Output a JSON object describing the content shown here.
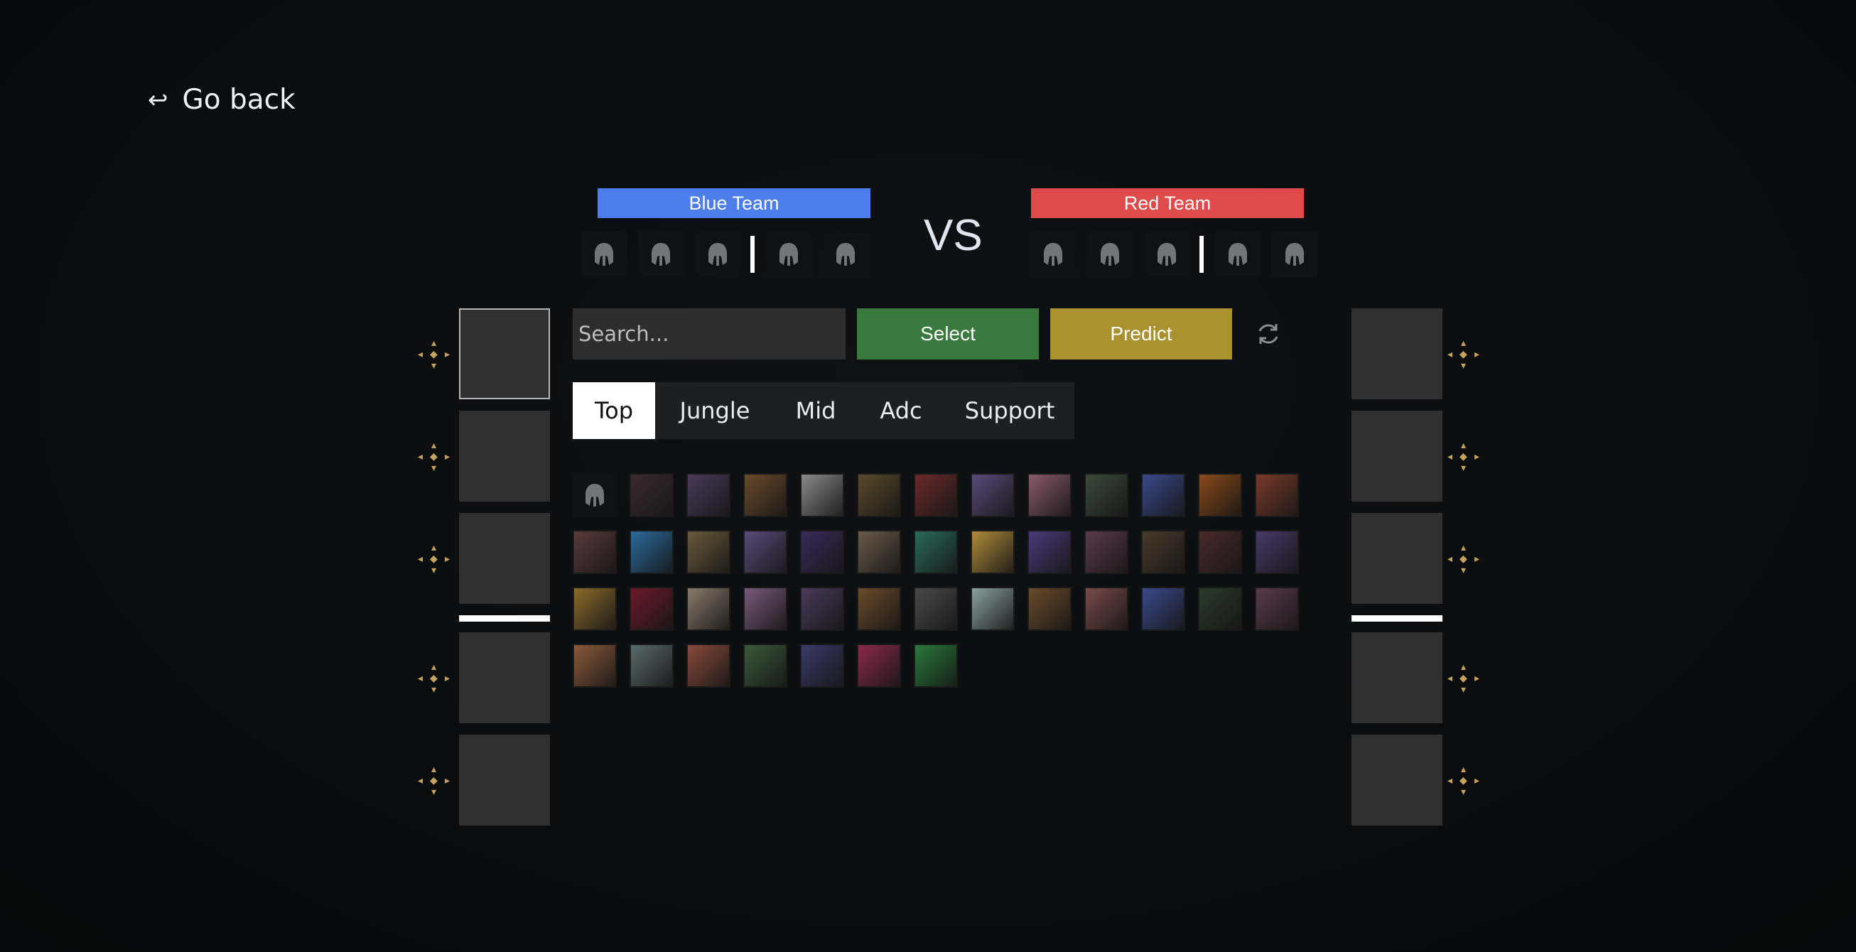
{
  "nav": {
    "back_label": "Go back",
    "back_icon": "return-arrow-icon"
  },
  "teams": {
    "blue": {
      "label": "Blue Team",
      "color": "#4b7ded"
    },
    "red": {
      "label": "Red Team",
      "color": "#e04a4a"
    },
    "vs_label": "VS"
  },
  "controls": {
    "search_placeholder": "Search...",
    "select_label": "Select",
    "predict_label": "Predict",
    "select_color": "#3a7a3e",
    "predict_color": "#a9912f",
    "refresh_icon": "refresh-icon"
  },
  "roles": {
    "selected": "Top",
    "items": [
      "Top",
      "Jungle",
      "Mid",
      "Adc",
      "Support"
    ]
  },
  "champions": {
    "placeholder_icon": "helmet-icon",
    "count": 46,
    "tile_colors": [
      "#0d1216",
      "#3a2a30",
      "#4a3a5a",
      "#6a4a2a",
      "#8a8a8a",
      "#5a4a2a",
      "#6a2a2a",
      "#5a4a7a",
      "#8a5a6a",
      "#3a4a3a",
      "#3a4a8a",
      "#8a4a1a",
      "#7a3a2a",
      "#5a3a3a",
      "#2a6a9a",
      "#6a5a3a",
      "#5a4a7a",
      "#3a2a5a",
      "#6a5a4a",
      "#2a6a5a",
      "#b08a3a",
      "#4a3a7a",
      "#5a3a4a",
      "#4a3a2a",
      "#4a2a2a",
      "#4a3a6a",
      "#8a6a2a",
      "#6a1a2a",
      "#8a7a6a",
      "#7a5a7a",
      "#4a3a5a",
      "#6a4a2a",
      "#4a4a4a",
      "#8aa0a0",
      "#6a4a2a",
      "#7a4a4a",
      "#3a4a8a",
      "#2a3a2a",
      "#5a3a4a",
      "#8a5a3a",
      "#5a6a6a",
      "#8a4a3a",
      "#3a5a3a",
      "#3a3a6a",
      "#8a2a4a",
      "#2a7a3a"
    ]
  },
  "picks": {
    "blue_slots": 5,
    "red_slots": 5
  }
}
